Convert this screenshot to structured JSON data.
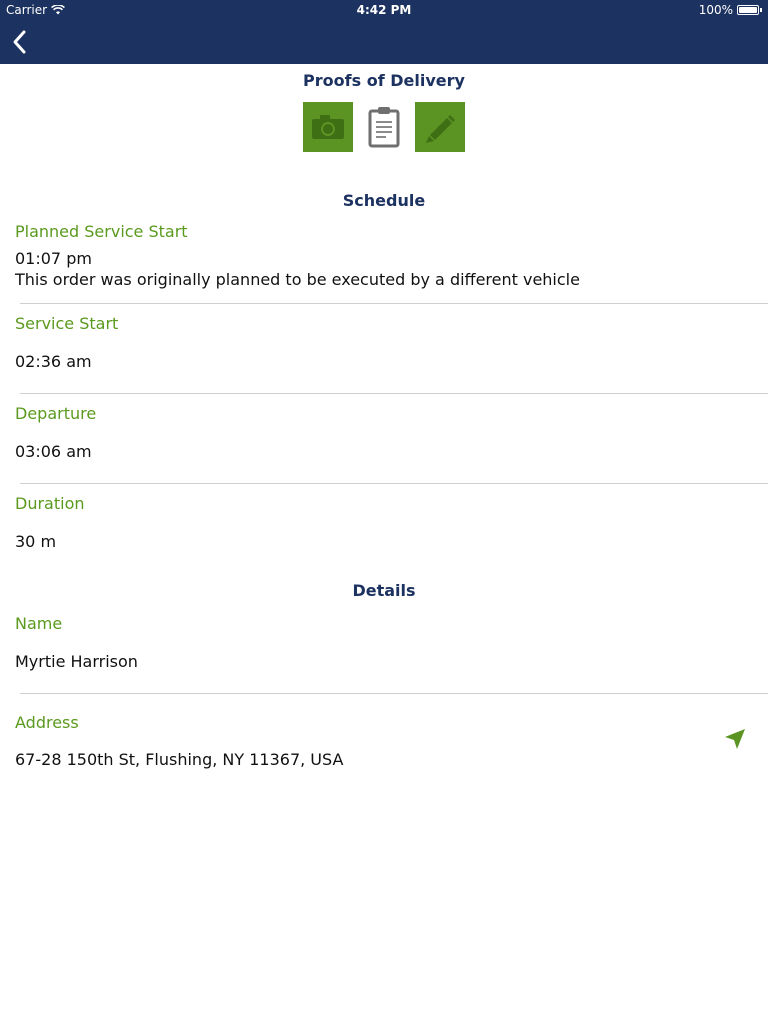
{
  "status_bar": {
    "carrier": "Carrier",
    "time": "4:42 PM",
    "battery": "100%"
  },
  "nav": {
    "back_icon": "chevron-left-icon"
  },
  "proofs": {
    "title": "Proofs of Delivery",
    "icons": [
      "camera-icon",
      "clipboard-icon",
      "pencil-icon"
    ]
  },
  "schedule": {
    "heading": "Schedule",
    "planned_start_label": "Planned Service Start",
    "planned_start_value": "01:07 pm",
    "planned_start_note": "This order was originally planned to be executed by a different vehicle",
    "service_start_label": "Service Start",
    "service_start_value": "02:36 am",
    "departure_label": "Departure",
    "departure_value": "03:06 am",
    "duration_label": "Duration",
    "duration_value": "30 m"
  },
  "details": {
    "heading": "Details",
    "name_label": "Name",
    "name_value": "Myrtie Harrison",
    "address_label": "Address",
    "address_value": "67-28 150th St, Flushing, NY 11367, USA",
    "navigate_icon": "navigation-arrow-icon"
  },
  "colors": {
    "navbar": "#1c3260",
    "accent_green": "#5b9422",
    "label_green": "#5a9a1e",
    "heading_blue": "#1c3260"
  }
}
